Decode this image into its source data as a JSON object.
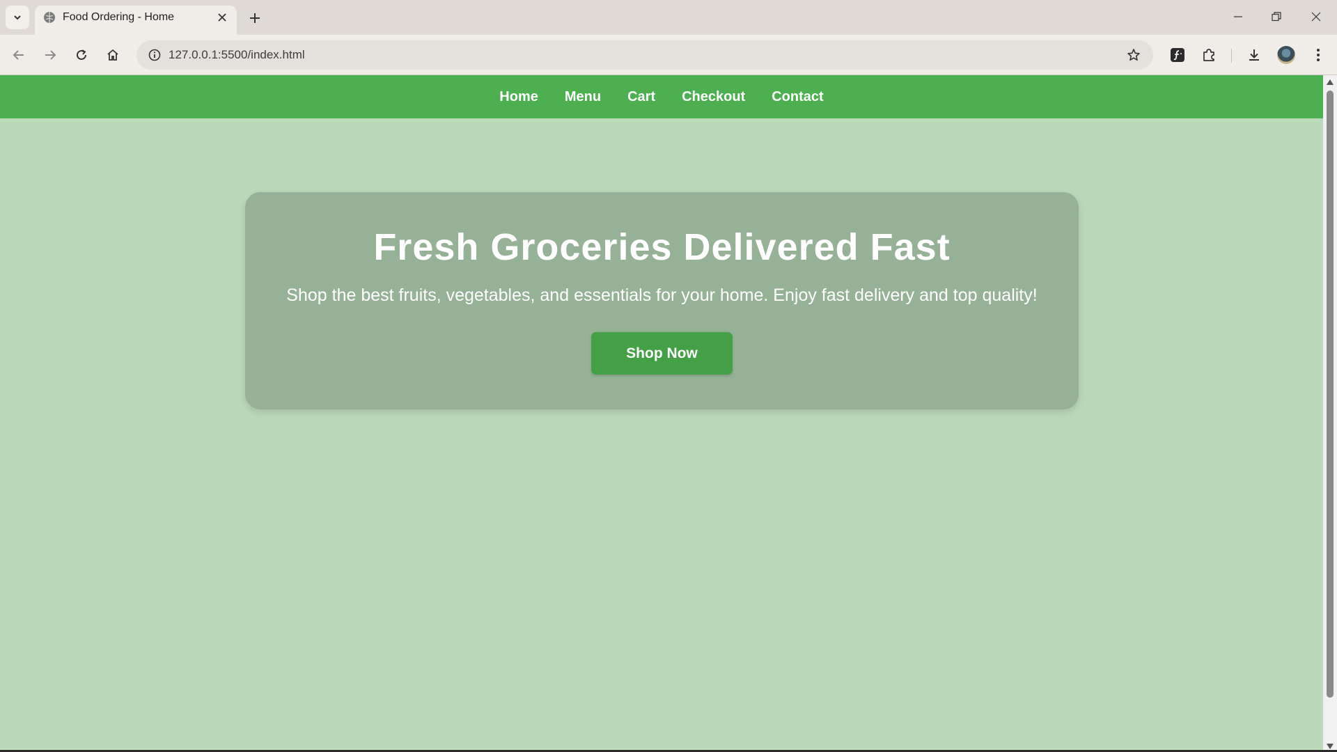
{
  "browser": {
    "tab_title": "Food Ordering - Home",
    "url": "127.0.0.1:5500/index.html",
    "icons": [
      "tab-search-icon",
      "globe-icon",
      "close-icon",
      "plus-icon",
      "minimize-icon",
      "restore-icon",
      "window-close-icon",
      "back-icon",
      "forward-icon",
      "reload-icon",
      "home-icon",
      "info-icon",
      "star-icon",
      "formula-extension-icon",
      "extensions-icon",
      "download-icon",
      "profile-avatar",
      "more-menu-icon"
    ]
  },
  "nav": {
    "items": [
      "Home",
      "Menu",
      "Cart",
      "Checkout",
      "Contact"
    ]
  },
  "hero": {
    "title": "Fresh Groceries Delivered Fast",
    "subtitle": "Shop the best fruits, vegetables, and essentials for your home. Enjoy fast delivery and top quality!",
    "button_label": "Shop Now"
  },
  "colors": {
    "navbar": "#4caf50",
    "page_background": "#b9d9b8",
    "hero_card": "#95b296",
    "button": "#43a047",
    "text": "#ffffff"
  }
}
